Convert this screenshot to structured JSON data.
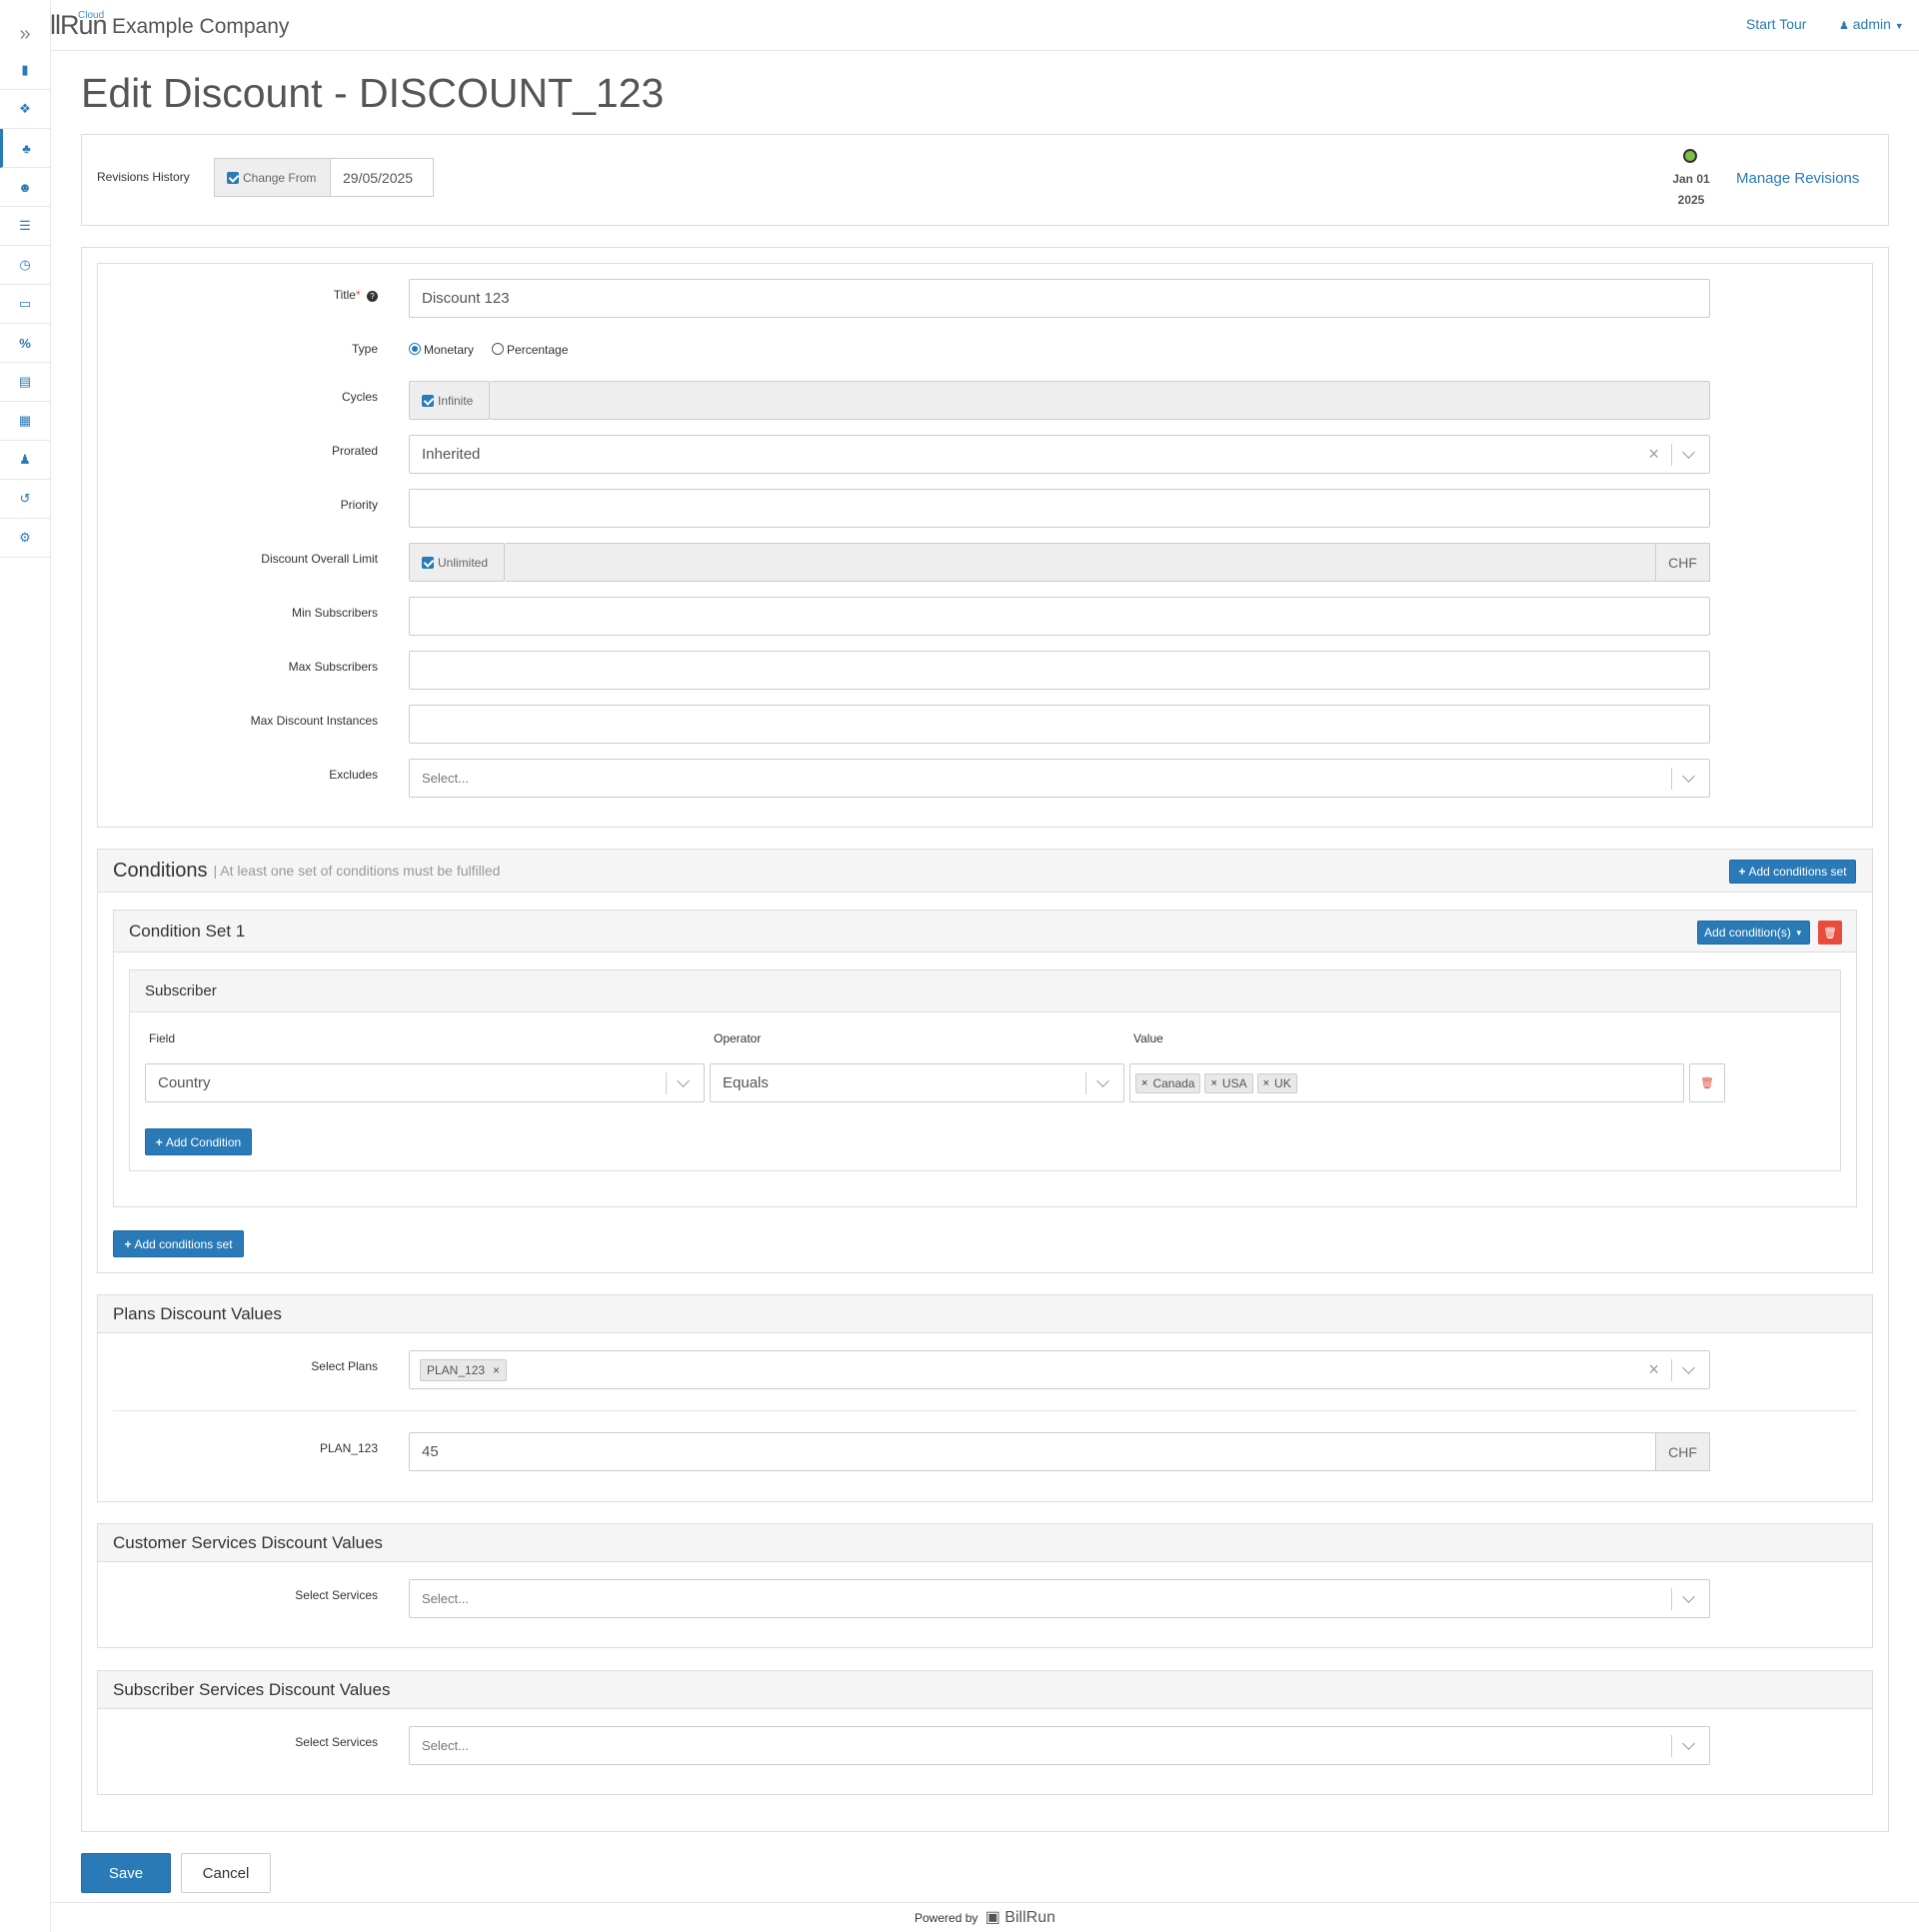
{
  "app": {
    "logo_text": "BillRun",
    "logo_cloud": "Cloud",
    "company": "Example Company"
  },
  "topnav": {
    "start_tour": "Start Tour",
    "user": "admin"
  },
  "sidebar": {
    "toggle_icon": "double-chevron-right-icon",
    "items": [
      {
        "icon": "book-icon"
      },
      {
        "icon": "cubes-icon"
      },
      {
        "icon": "puzzle-icon",
        "active": true
      },
      {
        "icon": "users-icon"
      },
      {
        "icon": "list-icon"
      },
      {
        "icon": "clock-icon"
      },
      {
        "icon": "file-icon"
      },
      {
        "icon": "percent-icon"
      },
      {
        "icon": "card-icon"
      },
      {
        "icon": "table-icon"
      },
      {
        "icon": "user-icon"
      },
      {
        "icon": "history-icon"
      },
      {
        "icon": "gear-icon"
      }
    ]
  },
  "page": {
    "title": "Edit Discount - DISCOUNT_123"
  },
  "revisions": {
    "label": "Revisions History",
    "change_from": "Change From",
    "date": "29/05/2025",
    "rev_date_line1": "Jan 01",
    "rev_date_line2": "2025",
    "manage": "Manage Revisions"
  },
  "form": {
    "title_label": "Title",
    "title_required": "*",
    "title_help": "?",
    "title_value": "Discount 123",
    "type_label": "Type",
    "type_options": [
      "Monetary",
      "Percentage"
    ],
    "type_selected": "Monetary",
    "cycles_label": "Cycles",
    "cycles_infinite": "Infinite",
    "prorated_label": "Prorated",
    "prorated_value": "Inherited",
    "priority_label": "Priority",
    "limit_label": "Discount Overall Limit",
    "limit_unlimited": "Unlimited",
    "currency": "CHF",
    "min_subs_label": "Min Subscribers",
    "max_subs_label": "Max Subscribers",
    "max_inst_label": "Max Discount Instances",
    "excludes_label": "Excludes",
    "select_placeholder": "Select..."
  },
  "conditions": {
    "title": "Conditions",
    "hint": "| At least one set of conditions must be fulfilled",
    "add_set": "Add conditions set",
    "set_title": "Condition Set 1",
    "add_conditions": "Add condition(s)",
    "group_title": "Subscriber",
    "field_header": "Field",
    "operator_header": "Operator",
    "value_header": "Value",
    "field_value": "Country",
    "operator_value": "Equals",
    "values": [
      "Canada",
      "USA",
      "UK"
    ],
    "add_condition": "Add Condition"
  },
  "plans": {
    "title": "Plans Discount Values",
    "select_label": "Select Plans",
    "selected": [
      "PLAN_123"
    ],
    "plan_label": "PLAN_123",
    "plan_value": "45"
  },
  "customer_services": {
    "title": "Customer Services Discount Values",
    "select_label": "Select Services"
  },
  "subscriber_services": {
    "title": "Subscriber Services Discount Values",
    "select_label": "Select Services"
  },
  "actions": {
    "save": "Save",
    "cancel": "Cancel"
  },
  "footer": {
    "powered_by": "Powered by",
    "brand": "BillRun"
  },
  "colors": {
    "primary": "#2a7ab8",
    "danger": "#e74c3c",
    "status_active": "#7cc242"
  }
}
